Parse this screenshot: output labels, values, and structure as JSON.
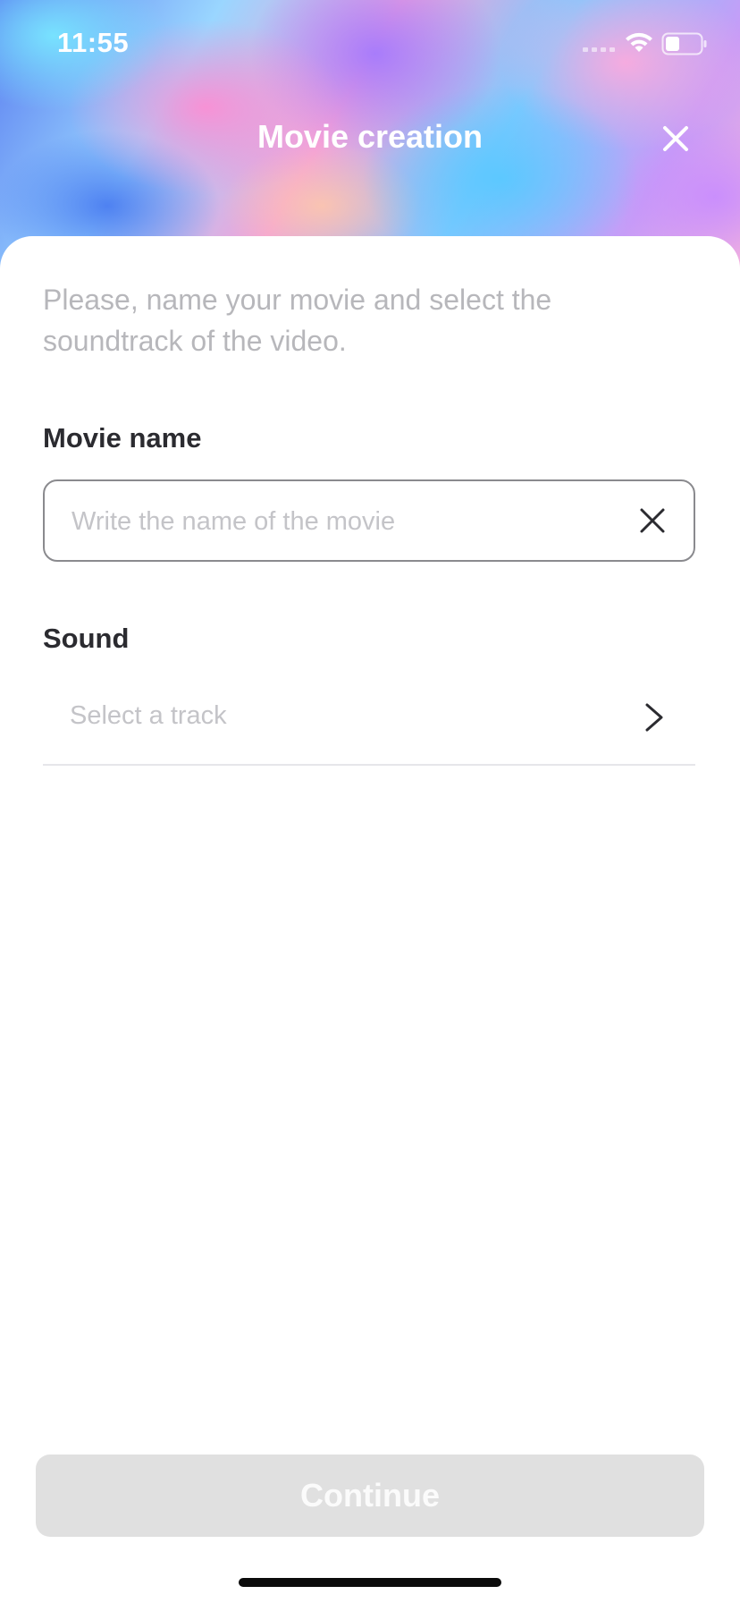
{
  "status_bar": {
    "time": "11:55",
    "icons": [
      "signal-icon",
      "wifi-icon",
      "battery-icon"
    ]
  },
  "header": {
    "title": "Movie creation",
    "close_icon": "close-icon"
  },
  "form": {
    "intro_text": "Please, name your movie and select the soundtrack of the video.",
    "movie_name": {
      "label": "Movie name",
      "value": "",
      "placeholder": "Write the name of the movie",
      "clear_icon": "clear-icon"
    },
    "sound": {
      "label": "Sound",
      "placeholder": "Select a track",
      "chevron_icon": "chevron-right-icon"
    }
  },
  "footer": {
    "continue_label": "Continue",
    "continue_enabled": false
  },
  "colors": {
    "text_primary": "#2b2b30",
    "text_secondary": "#b7b7bb",
    "placeholder": "#c4c4c8",
    "button_disabled_bg": "#e0e0e0",
    "button_disabled_text": "#fbfbfb",
    "field_border": "#8a8a8e"
  }
}
